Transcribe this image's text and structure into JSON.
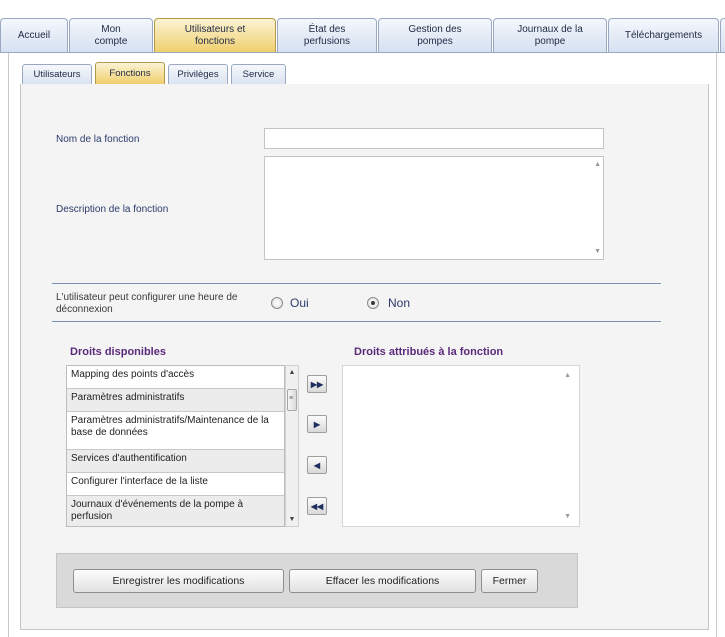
{
  "main_tabs": [
    {
      "label": "Accueil"
    },
    {
      "label": "Mon compte"
    },
    {
      "label": "Utilisateurs et fonctions"
    },
    {
      "label": "État des perfusions"
    },
    {
      "label": "Gestion des pompes"
    },
    {
      "label": "Journaux de la pompe"
    },
    {
      "label": "Téléchargements"
    }
  ],
  "sub_tabs": [
    {
      "label": "Utilisateurs"
    },
    {
      "label": "Fonctions"
    },
    {
      "label": "Privilèges"
    },
    {
      "label": "Service"
    }
  ],
  "form": {
    "name_label": "Nom de la fonction",
    "name_value": "",
    "description_label": "Description de la fonction",
    "description_value": "",
    "logout_label": "L'utilisateur peut configurer une heure de déconnexion",
    "option_yes": "Oui",
    "option_no": "Non",
    "selected_option": "Non"
  },
  "rights": {
    "available_title": "Droits disponibles",
    "assigned_title": "Droits attribués à la fonction",
    "available": [
      "Mapping des points d'accès",
      "Paramètres administratifs",
      "Paramètres administratifs/Maintenance de la base de données",
      "Services d'authentification",
      "Configurer l'interface de la liste",
      "Journaux d'événements de la pompe à perfusion"
    ],
    "assigned": [],
    "move_buttons": [
      "move-all-right",
      "move-right",
      "move-left",
      "move-all-left"
    ]
  },
  "actions": {
    "save": "Enregistrer les modifications",
    "clear": "Effacer les modifications",
    "close": "Fermer"
  }
}
